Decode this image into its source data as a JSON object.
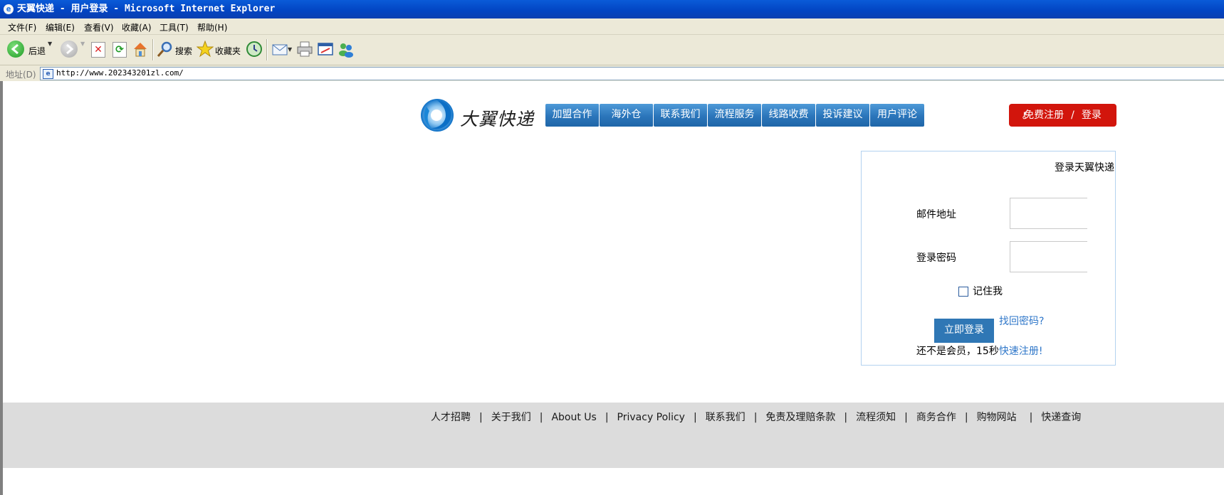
{
  "window": {
    "title": "天翼快递 - 用户登录 - Microsoft Internet Explorer",
    "ie_icon": "e"
  },
  "menubar": {
    "items": [
      "文件(F)",
      "编辑(E)",
      "查看(V)",
      "收藏(A)",
      "工具(T)",
      "帮助(H)"
    ]
  },
  "toolbar": {
    "back_label": "后退",
    "search_label": "搜索",
    "favorites_label": "收藏夹",
    "icons": [
      "back-icon",
      "forward-icon",
      "stop-icon",
      "refresh-icon",
      "home-icon",
      "search-icon",
      "favorites-star-icon",
      "history-icon",
      "mail-icon",
      "print-icon",
      "edit-icon",
      "messenger-icon"
    ]
  },
  "addressbar": {
    "label": "地址(D)",
    "url": "http://www.202343201zl.com/"
  },
  "site": {
    "logo_text": "大翼快递",
    "nav_items": [
      "加盟合作",
      "海外仓",
      "联系我们",
      "流程服务",
      "线路收费",
      "投诉建议",
      "用户评论"
    ],
    "register_label": "免费注册",
    "register_sep": "/",
    "login_label": "登录",
    "colors": {
      "nav_blue": "#2b75ba",
      "register_red": "#d2150c",
      "link_blue": "#2f77c9",
      "footer_gray": "#dcdcdc"
    }
  },
  "login": {
    "title": "登录天翼快递",
    "email_label": "邮件地址",
    "email_value": "",
    "password_label": "登录密码",
    "password_value": "",
    "remember_label": "记住我",
    "remember_checked": false,
    "submit_label": "立即登录",
    "forgot_label": "找回密码?",
    "notice_prefix": "还不是会员，15秒",
    "notice_link": "快速注册!"
  },
  "footer": {
    "links": [
      "人才招聘",
      "关于我们",
      "About Us",
      "Privacy Policy",
      "联系我们",
      "免责及理赔条款",
      "流程须知",
      "商务合作",
      "购物网站",
      "快递查询"
    ],
    "separator": "|"
  }
}
